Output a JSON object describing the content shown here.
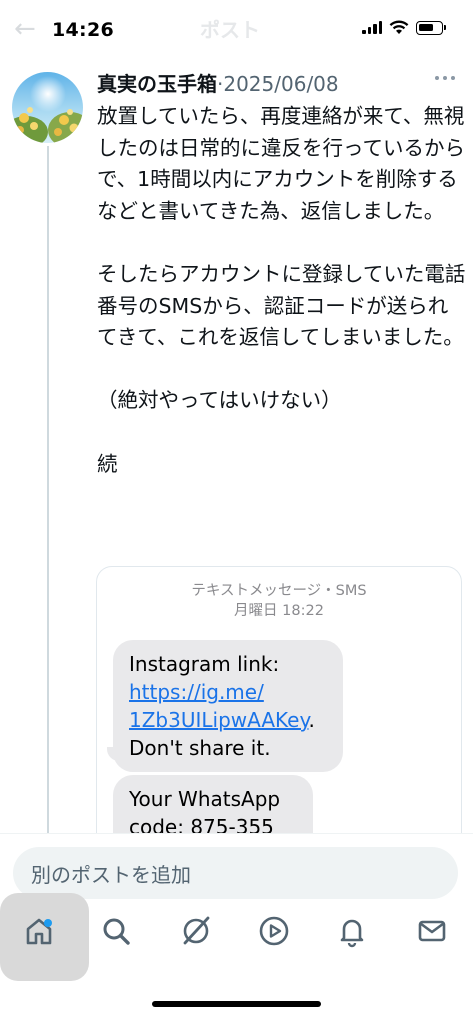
{
  "status_bar": {
    "time": "14:26"
  },
  "nav": {
    "back_icon": "←",
    "title": "ポスト"
  },
  "tweet": {
    "author_name": "真実の玉手箱",
    "separator": "·",
    "date": "2025/06/08",
    "paragraphs": [
      "放置していたら、再度連絡が来て、無視したのは日常的に違反を行っているからで、1時間以内にアカウントを削除するなどと書いてきた為、返信しました。",
      "そしたらアカウントに登録していた電話番号のSMSから、認証コードが送られてきて、これを返信してしまいました。",
      "（絶対やってはいけない）",
      "続"
    ]
  },
  "sms_image": {
    "header_line1": "テキストメッセージ・SMS",
    "header_line2": "月曜日 18:22",
    "bubble1": {
      "line1": "Instagram link:",
      "link_part1": "https://ig.me/",
      "link_part2": "1Zb3UILipwAAKey",
      "link_suffix": ".",
      "line3": "Don't share it."
    },
    "bubble2": {
      "line1": "Your WhatsApp",
      "line2": "code: 875-355"
    }
  },
  "composer": {
    "placeholder": "別のポストを追加"
  },
  "tab_bar": {
    "tabs": [
      {
        "name": "home",
        "icon": "home-icon"
      },
      {
        "name": "search",
        "icon": "search-icon"
      },
      {
        "name": "grok",
        "icon": "grok-icon"
      },
      {
        "name": "video",
        "icon": "play-icon"
      },
      {
        "name": "notifications",
        "icon": "bell-icon"
      },
      {
        "name": "messages",
        "icon": "mail-icon"
      }
    ]
  },
  "colors": {
    "text": "#0f1419",
    "secondary_text": "#536471",
    "link": "#1a73e8",
    "sms_bubble": "#e9e9eb",
    "thread_line": "#cfd9de",
    "notification_dot": "#1d9bf0"
  }
}
